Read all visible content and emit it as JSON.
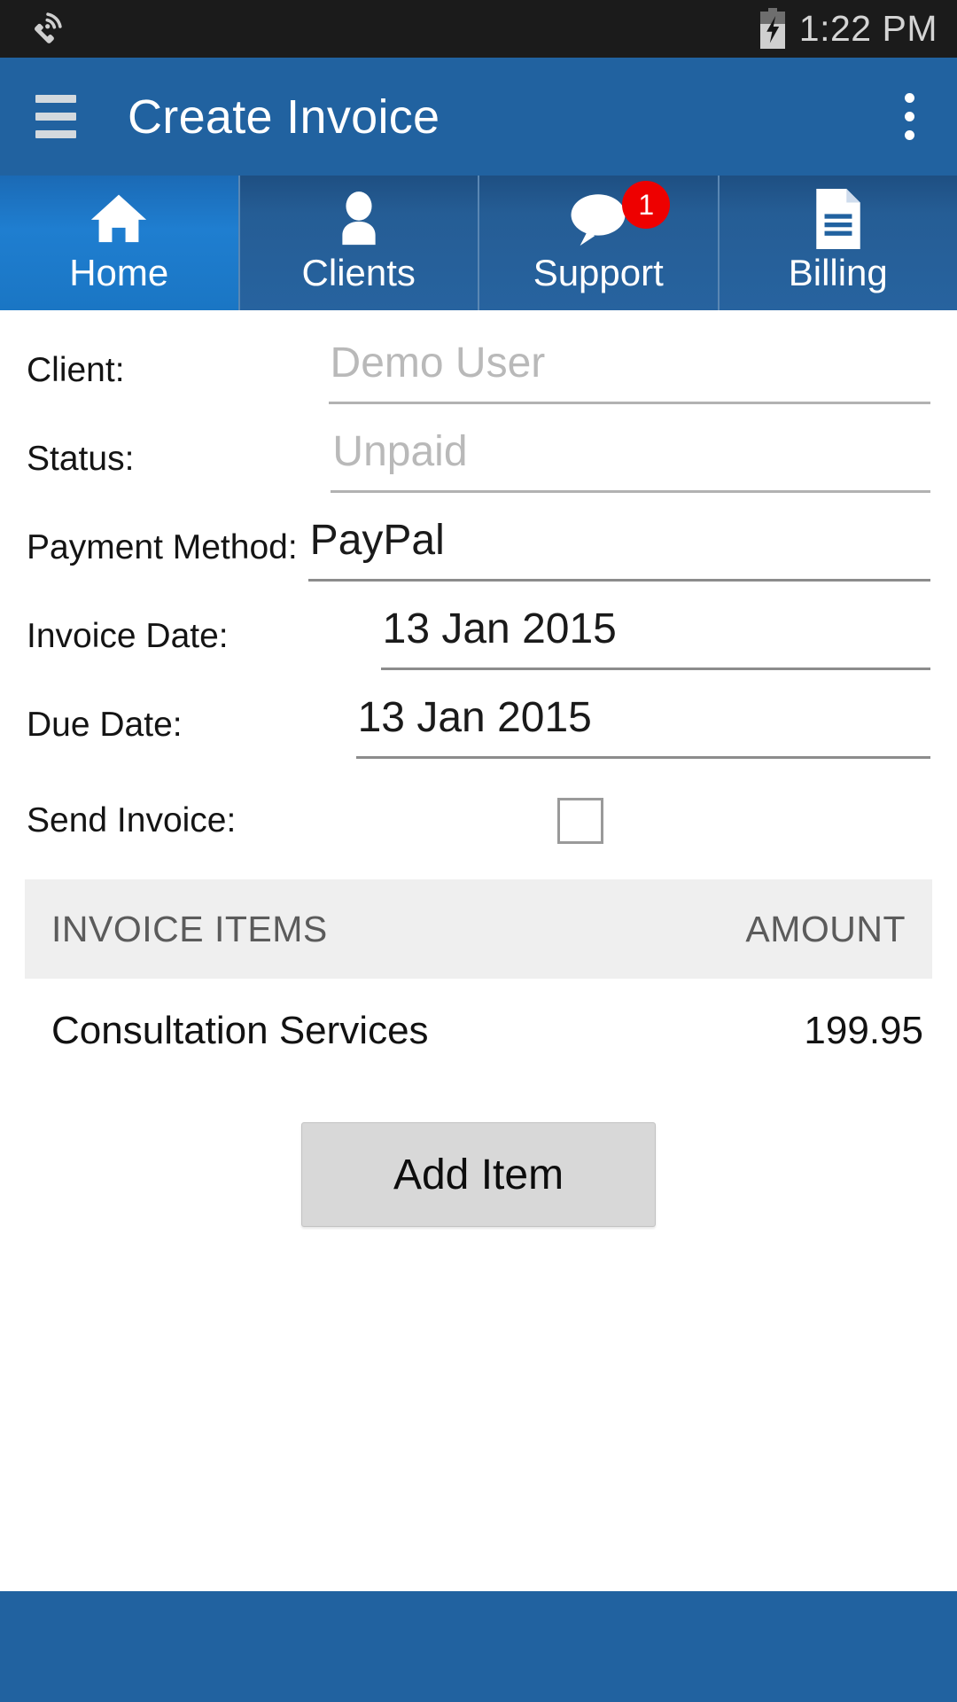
{
  "status_bar": {
    "wifi_call_icon": "wifi-call-icon",
    "battery_icon": "battery-charging-icon",
    "time": "1:22 PM"
  },
  "toolbar": {
    "menu_icon": "hamburger-menu-icon",
    "title": "Create Invoice",
    "overflow_icon": "overflow-menu-icon"
  },
  "tabs": [
    {
      "label": "Home",
      "icon": "home-icon",
      "active": true,
      "badge": ""
    },
    {
      "label": "Clients",
      "icon": "person-icon",
      "active": false,
      "badge": ""
    },
    {
      "label": "Support",
      "icon": "chat-bubble-icon",
      "active": false,
      "badge": "1"
    },
    {
      "label": "Billing",
      "icon": "document-icon",
      "active": false,
      "badge": ""
    }
  ],
  "form": {
    "client": {
      "label": "Client:",
      "value": "",
      "placeholder": "Demo User"
    },
    "status": {
      "label": "Status:",
      "value": "",
      "placeholder": "Unpaid"
    },
    "payment": {
      "label": "Payment Method:",
      "value": "PayPal",
      "placeholder": ""
    },
    "invoice_date": {
      "label": "Invoice Date:",
      "value": "13 Jan 2015",
      "placeholder": ""
    },
    "due_date": {
      "label": "Due Date:",
      "value": "13 Jan 2015",
      "placeholder": ""
    },
    "send_invoice": {
      "label": "Send Invoice:",
      "checked": false
    }
  },
  "items_table": {
    "columns": [
      "INVOICE ITEMS",
      "AMOUNT"
    ],
    "rows": [
      {
        "name": "Consultation Services",
        "amount": "199.95"
      }
    ]
  },
  "actions": {
    "add_item_label": "Add Item"
  },
  "colors": {
    "status_bar_bg": "#1b1b1b",
    "toolbar_bg": "#2162a0",
    "tab_bg": "#27639f",
    "tab_active_bg": "#1f7ed0",
    "badge_bg": "#ee0000",
    "table_header_bg": "#efefef",
    "button_bg": "#d8d8d8",
    "placeholder_text": "#b9b9b9"
  }
}
